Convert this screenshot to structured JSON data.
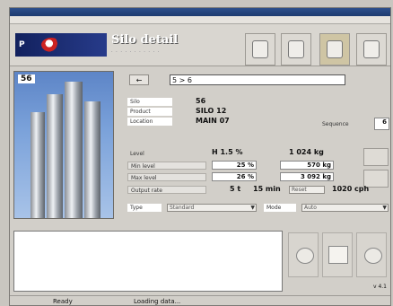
{
  "window": {
    "title": "",
    "menu": [
      "",
      "",
      "",
      ""
    ]
  },
  "banner": {
    "title": "Silo detail",
    "subtitle": "· · · · · · · · · · ·",
    "toolbar": [
      {
        "icon": "silo-icon",
        "active": false
      },
      {
        "icon": "document-icon",
        "active": false
      },
      {
        "icon": "folder-icon",
        "active": true
      },
      {
        "icon": "tool-icon",
        "active": false
      }
    ]
  },
  "photo": {
    "label": "56"
  },
  "nav": {
    "back_label": "←",
    "search_value": "5 > 6"
  },
  "info": {
    "rows": [
      {
        "label": "Silo",
        "value": "56"
      },
      {
        "label": "Product",
        "value": "SILO 12"
      },
      {
        "label": "Location",
        "value": "MAIN 07"
      }
    ],
    "right_label": "Sequence",
    "right_value": "6"
  },
  "measure": {
    "header_label": "Level",
    "header_value1": "H 1.5 %",
    "header_value2": "1 024 kg",
    "rows": [
      {
        "label": "Min level",
        "value1": "25 %",
        "value2": "570 kg"
      },
      {
        "label": "Max level",
        "value1": "26 %",
        "value2": "3 092 kg"
      }
    ],
    "extra_label": "Output rate",
    "extra_value1": "5 t",
    "extra_value2": "15 min",
    "extra_button": "Reset",
    "extra_value3": "1020 cph"
  },
  "dropdowns": {
    "d1_label": "Type",
    "d1_value": "Standard",
    "d2_label": "Mode",
    "d2_value": "Auto"
  },
  "bottom": {
    "version": "v 4.1"
  },
  "status": {
    "left": "Ready",
    "right": "Loading data..."
  }
}
